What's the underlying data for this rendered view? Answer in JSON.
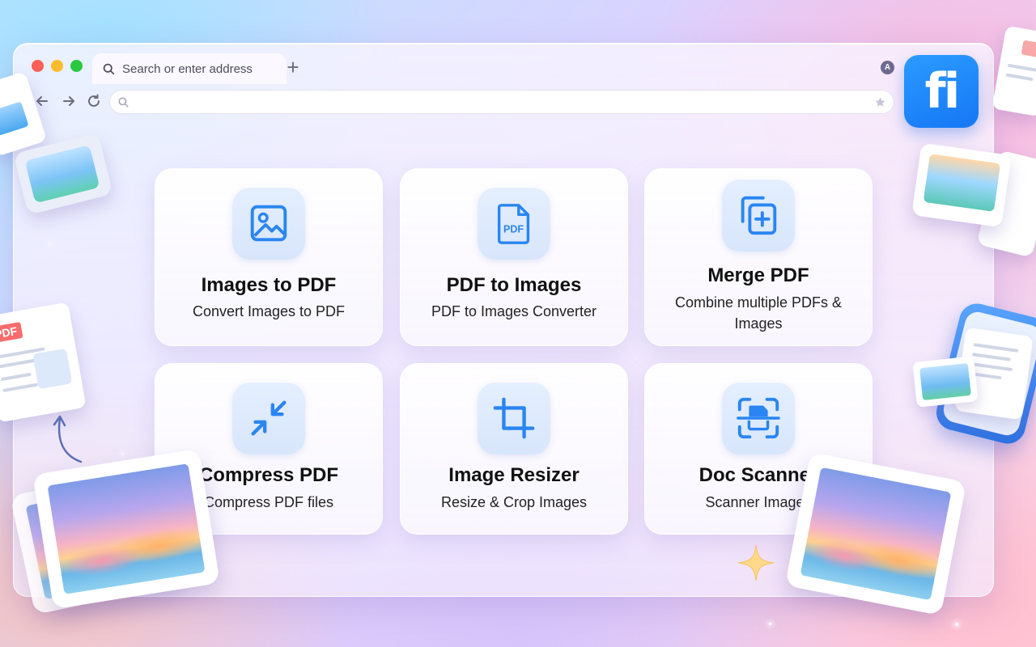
{
  "browser": {
    "tab_label": "Search or enter address",
    "new_tab_label": "+",
    "profile_initial": "A",
    "url_value": "",
    "icons": {
      "tab_search": "search-icon",
      "back": "arrow-left-icon",
      "forward": "arrow-right-icon",
      "reload": "reload-icon",
      "url_search": "search-icon",
      "bookmark": "star-icon"
    }
  },
  "app": {
    "logo_text": "fi",
    "accent_color": "#1677f5"
  },
  "tools": [
    {
      "title": "Images to PDF",
      "subtitle": "Convert Images to PDF",
      "icon": "image-icon"
    },
    {
      "title": "PDF to Images",
      "subtitle": "PDF to Images Converter",
      "icon": "pdf-file-icon",
      "icon_text": "PDF"
    },
    {
      "title": "Merge PDF",
      "subtitle": "Combine multiple PDFs & Images",
      "icon": "merge-copy-icon"
    },
    {
      "title": "Compress PDF",
      "subtitle": "Compress PDF files",
      "icon": "compress-arrows-icon"
    },
    {
      "title": "Image Resizer",
      "subtitle": "Resize & Crop Images",
      "icon": "crop-icon"
    },
    {
      "title": "Doc Scanner",
      "subtitle": "Scanner Images",
      "icon": "scanner-icon"
    }
  ],
  "decorations": {
    "pdf_tag": "PDF"
  }
}
